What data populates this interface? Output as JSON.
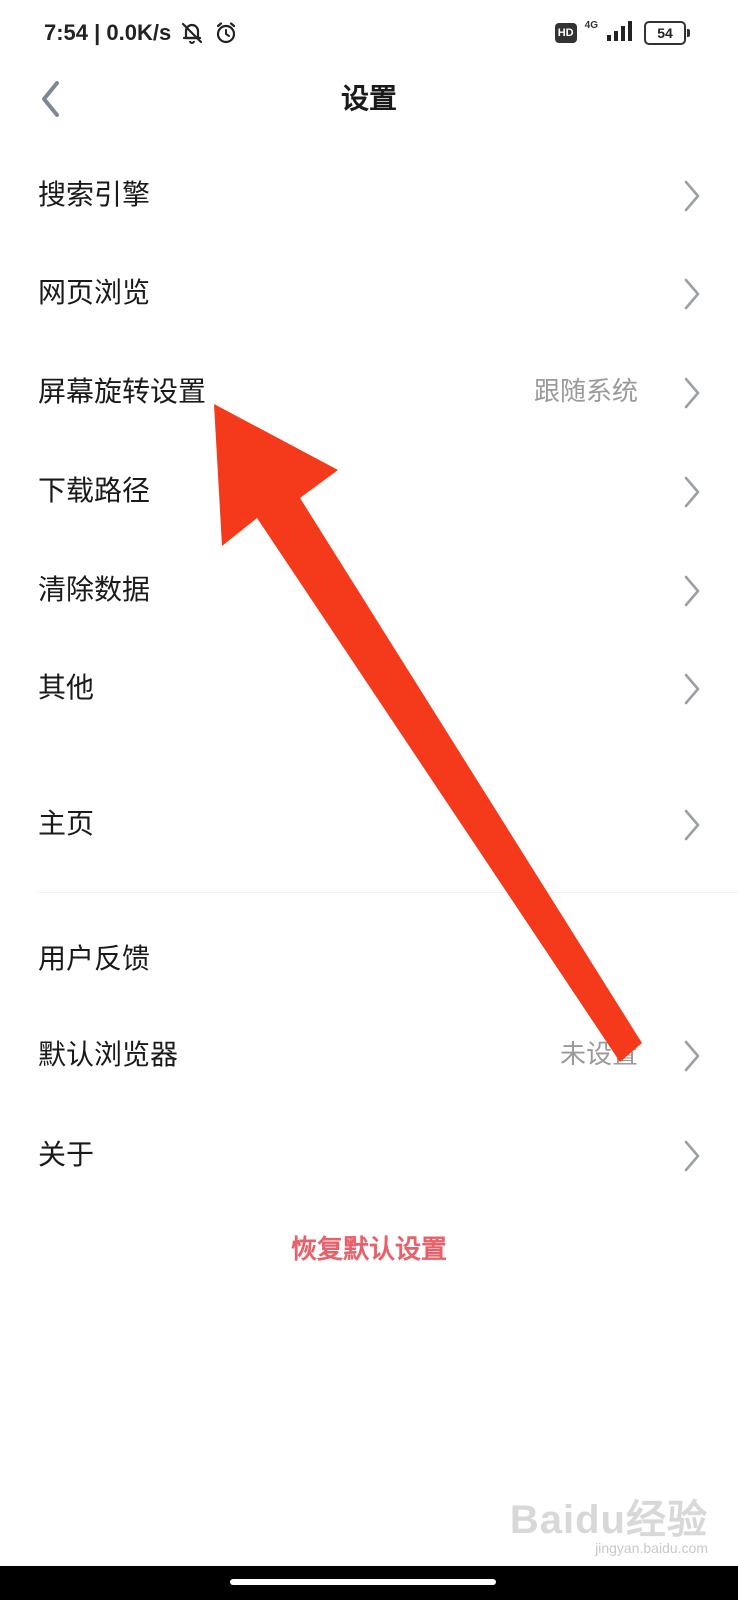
{
  "status_bar": {
    "time_speed": "7:54 | 0.0K/s",
    "hd_badge": "HD",
    "network_type": "4G",
    "battery_level": "54",
    "icons": [
      "mute-bell-icon",
      "alarm-clock-icon",
      "signal-icon",
      "battery-icon"
    ]
  },
  "header": {
    "title": "设置",
    "back_icon": "chevron-left-icon"
  },
  "settings": {
    "items": [
      {
        "label": "搜索引擎",
        "value": ""
      },
      {
        "label": "网页浏览",
        "value": ""
      },
      {
        "label": "屏幕旋转设置",
        "value": "跟随系统"
      },
      {
        "label": "下载路径",
        "value": ""
      },
      {
        "label": "清除数据",
        "value": ""
      },
      {
        "label": "其他",
        "value": ""
      },
      {
        "label": "主页",
        "value": ""
      },
      {
        "label": "用户反馈",
        "value": ""
      },
      {
        "label": "默认浏览器",
        "value": "未设置"
      },
      {
        "label": "关于",
        "value": ""
      }
    ]
  },
  "reset": {
    "label": "恢复默认设置"
  },
  "watermark": {
    "logo": "Baidu经验",
    "sub": "jingyan.baidu.com"
  },
  "colors": {
    "accent_reset": "#e8606a",
    "annotation_arrow": "#f43a1a",
    "secondary_text": "#9a9a9a",
    "chevron": "#9aa0a6"
  }
}
